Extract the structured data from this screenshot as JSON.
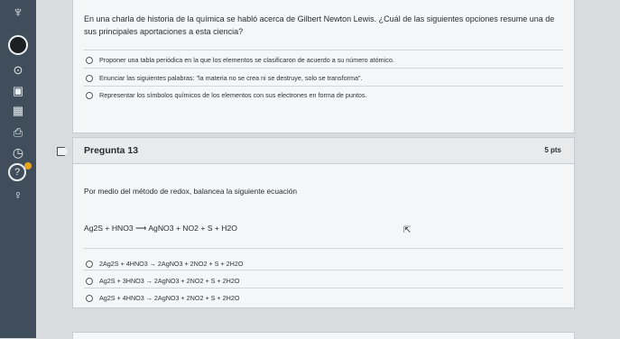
{
  "nav": {
    "items": [
      "logo-icon",
      "account-icon",
      "avatar-icon",
      "dashboard-icon",
      "calendar-icon",
      "inbox-icon",
      "history-icon",
      "help-icon",
      "bulb-icon"
    ]
  },
  "q12": {
    "text": "En una charla de historia de la química se habló acerca de Gilbert Newton Lewis. ¿Cuál de las siguientes opciones resume una de sus principales aportaciones a esta ciencia?",
    "options": [
      "Proponer una tabla periódica en la que los elementos se clasificaron de acuerdo a su número atómico.",
      "Enunciar las siguientes palabras: \"la materia no se crea ni se destruye, solo se transforma\".",
      "Representar los símbolos químicos de los elementos con sus electrones en forma de puntos."
    ]
  },
  "q13": {
    "title": "Pregunta 13",
    "points": "5 pts",
    "prompt": "Por medio del método de redox, balancea la siguiente ecuación",
    "equation": "Ag2S + HNO3 ⟶ AgNO3 + NO2 + S + H2O",
    "options": [
      "2Ag2S + 4HNO3 → 2AgNO3 + 2NO2 + S + 2H2O",
      "Ag2S + 3HNO3 → 2AgNO3 + 2NO2 + S + 2H2O",
      "Ag2S + 4HNO3 → 2AgNO3 + 2NO2 + S + 2H2O"
    ]
  }
}
